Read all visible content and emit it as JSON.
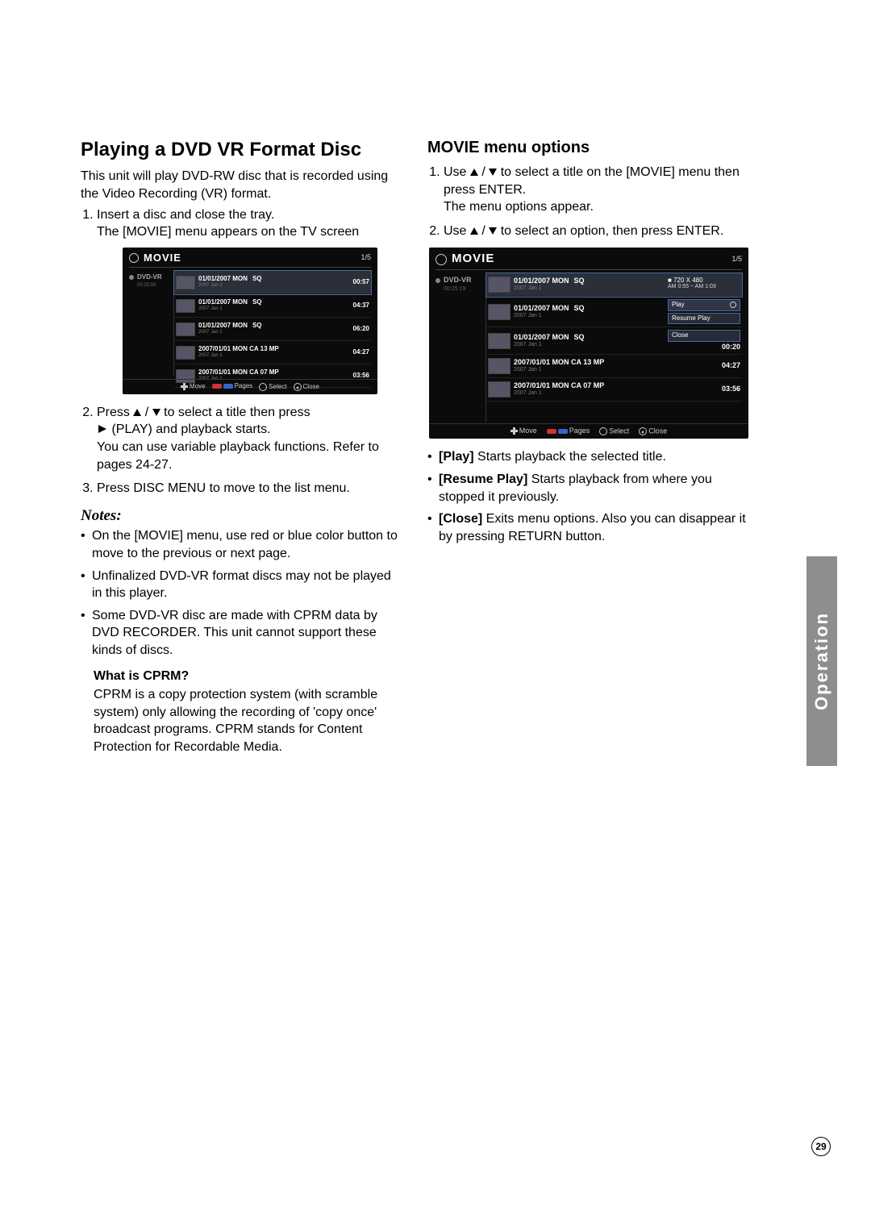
{
  "page_number": "29",
  "side_tab": "Operation",
  "left": {
    "heading": "Playing a DVD VR Format Disc",
    "intro": "This unit will play DVD-RW disc that is recorded using the Video Recording (VR) format.",
    "steps": {
      "s1a": "Insert a disc and close the tray.",
      "s1b": "The [MOVIE] menu appears on the TV screen",
      "s2a_pre": "Press ",
      "s2a_mid1": " / ",
      "s2a_mid2": " to select a title then press ",
      "s2a_post": " (PLAY) and playback starts.",
      "s2b": "You can use variable playback functions. Refer to pages 24-27.",
      "s3": "Press DISC MENU to move to the list menu."
    },
    "notes_title": "Notes:",
    "notes": {
      "n1": "On the [MOVIE] menu, use red or blue color button to move to the previous or next page.",
      "n2": "Unfinalized DVD-VR format discs may not be played in this player.",
      "n3": "Some DVD-VR disc are made with CPRM data by DVD RECORDER. This unit cannot support these kinds of discs."
    },
    "cprm_head": "What is CPRM?",
    "cprm_body": "CPRM is a copy protection system (with scramble system) only allowing the recording of 'copy once' broadcast programs. CPRM stands for Content Protection for Recordable Media."
  },
  "right": {
    "heading": "MOVIE menu options",
    "steps": {
      "s1a_pre": "Use ",
      "s1a_mid": " / ",
      "s1a_post": " to select a title on the [MOVIE] menu then press ENTER.",
      "s1b": "The menu options appear.",
      "s2_pre": "Use ",
      "s2_mid": " / ",
      "s2_post": " to select an option, then press ENTER."
    },
    "options": {
      "play_label": "[Play]",
      "play_text": " Starts playback the selected title.",
      "resume_label": "[Resume Play]",
      "resume_text": " Starts playback from where you stopped it previously.",
      "close_label": "[Close]",
      "close_text": " Exits menu options. Also you can disappear it by pressing RETURN button."
    }
  },
  "osd1": {
    "title": "MOVIE",
    "counter": "1/5",
    "disc_name": "DVD-VR",
    "disc_time": "00:25:00",
    "rows": [
      {
        "date": "01/01/2007 MON",
        "q": "SQ",
        "sub": "2007 Jan 1",
        "dur": "00:57",
        "sel": true
      },
      {
        "date": "01/01/2007 MON",
        "q": "SQ",
        "sub": "2007 Jan 1",
        "dur": "04:37",
        "sel": false
      },
      {
        "date": "01/01/2007 MON",
        "q": "SQ",
        "sub": "2007 Jan 1",
        "dur": "06:20",
        "sel": false
      },
      {
        "date": "2007/01/01 MON CA 13 MP",
        "q": "",
        "sub": "2007 Jan 1",
        "dur": "04:27",
        "sel": false
      },
      {
        "date": "2007/01/01 MON CA 07 MP",
        "q": "",
        "sub": "2007 Jan 1",
        "dur": "03:56",
        "sel": false
      }
    ],
    "bottom": {
      "move": "Move",
      "pages": "Pages",
      "select": "Select",
      "close": "Close"
    }
  },
  "osd2": {
    "title": "MOVIE",
    "counter": "1/5",
    "disc_name": "DVD-VR",
    "disc_time": "00:25:19",
    "info_res": "720 X 480",
    "info_time": "AM 0:55 ~ AM 1:03",
    "menu": {
      "play": "Play",
      "resume": "Resume Play",
      "close": "Close"
    },
    "rows": [
      {
        "date": "01/01/2007 MON",
        "q": "SQ",
        "sub": "2007 Jan 1",
        "dur": "",
        "sel": true
      },
      {
        "date": "01/01/2007 MON",
        "q": "SQ",
        "sub": "2007 Jan 1",
        "dur": "",
        "sel": false
      },
      {
        "date": "01/01/2007 MON",
        "q": "SQ",
        "sub": "2007 Jan 1",
        "dur": "00:20",
        "sel": false
      },
      {
        "date": "2007/01/01 MON CA 13 MP",
        "q": "",
        "sub": "2007 Jan 1",
        "dur": "04:27",
        "sel": false
      },
      {
        "date": "2007/01/01 MON CA 07 MP",
        "q": "",
        "sub": "2007 Jan 1",
        "dur": "03:56",
        "sel": false
      }
    ],
    "bottom": {
      "move": "Move",
      "pages": "Pages",
      "select": "Select",
      "close": "Close"
    }
  }
}
